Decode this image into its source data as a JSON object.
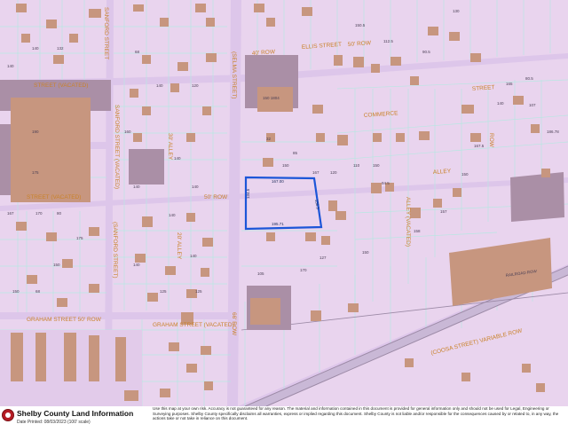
{
  "map": {
    "streets": [
      "ELLIS STREET",
      "50' ROW",
      "40' ROW",
      "(SELMA STREET)",
      "STREET (VACATED)",
      "SANFORD STREET (VACATED)",
      "SANFORD STREET",
      "(SANFORD STREET)",
      "30' ALLEY",
      "20' ALLEY",
      "ALLEY",
      "ALLEY (VACATED)",
      "STREET (VACATED)",
      "COMMERCE",
      "STREET",
      "GRAHAM STREET 50' ROW",
      "GRAHAM STREET (VACATED)",
      "66' ROW",
      "(COOSA STREET) VARIABLE ROW",
      "RAILROAD ROW",
      "ROW",
      "50' ROW"
    ],
    "subject_parcel_dims": [
      "167.00",
      "195.71",
      "156.5",
      "134.5"
    ],
    "parcel_dims": [
      "140",
      "132",
      "140",
      "190",
      "175",
      "167",
      "170",
      "80",
      "68",
      "140",
      "120",
      "160",
      "140",
      "140",
      "140",
      "140",
      "140",
      "140",
      "125",
      "125",
      "150",
      "175",
      "150",
      "68",
      "32",
      "85",
      "150",
      "167",
      "120",
      "110",
      "150",
      "94.5",
      "127",
      "170",
      "105",
      "150",
      "158",
      "157",
      "150",
      "140",
      "107",
      "186.78",
      "150.5",
      "112.5",
      "130",
      "90.5",
      "80.5",
      "167.5",
      "165"
    ],
    "building_labels": [
      "150 1804"
    ]
  },
  "footer": {
    "brand": "Shelby County Land Information",
    "date_printed": "Date Printed: 08/03/2023 (100' scale)",
    "disclaimer": "Use this map at your own risk.  Accuracy is not guaranteed for any reason.  The material and information contained in this document is provided for general information only and should not be used for Legal, Engineering or Surveying purposes. Shelby County specifically disclaims all warranties, express or implied regarding this document.  Shelby County is not liable and/or responsible for the consequences caused by or related to, in any way, the actions take or not take in reliance on this document."
  },
  "colors": {
    "parcel_fill": "#e9d4ee",
    "parcel_line": "#b7e7e2",
    "building": "#c7967f",
    "road": "#c9b5dd",
    "street_label": "#c9822a",
    "subject_outline": "#1c56d8",
    "railroad": "#9c8aa6",
    "commercial": "#aa8fa6"
  }
}
